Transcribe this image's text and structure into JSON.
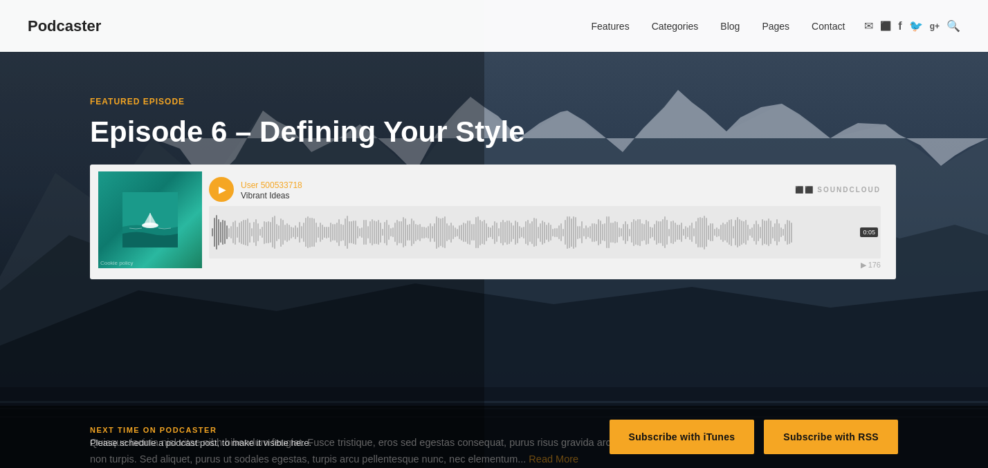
{
  "brand": "Podcaster",
  "nav": {
    "links": [
      {
        "label": "Features",
        "id": "features"
      },
      {
        "label": "Categories",
        "id": "categories"
      },
      {
        "label": "Blog",
        "id": "blog"
      },
      {
        "label": "Pages",
        "id": "pages"
      },
      {
        "label": "Contact",
        "id": "contact"
      }
    ],
    "icons": [
      {
        "name": "mail-icon",
        "glyph": "✉"
      },
      {
        "name": "rss-icon",
        "glyph": "◈"
      },
      {
        "name": "facebook-icon",
        "glyph": "f"
      },
      {
        "name": "twitter-icon",
        "glyph": "t"
      },
      {
        "name": "googleplus-icon",
        "glyph": "g+"
      },
      {
        "name": "search-icon",
        "glyph": "🔍"
      }
    ]
  },
  "hero": {
    "featured_label": "Featured Episode",
    "episode_title": "Episode 6 – Defining Your Style",
    "player": {
      "track_user": "User 500533718",
      "track_name": "Vibrant Ideas",
      "soundcloud_label": "⬛⬛ SOUNDCLOUD",
      "time": "0:05",
      "play_count": "▶ 176",
      "cookie_text": "Cookie policy"
    },
    "description": "Quisque lacinia nisl vitae nibh bibendum feugiat. Fusce tristique, eros sed egestas consequat, purus risus gravida arcu, non euismod lorem libero non turpis. Sed aliquet, purus ut sodales egestas, turpis arcu pellentesque nunc, nec elementum...",
    "read_more": "Read More"
  },
  "footer": {
    "next_label": "NEXT TIME ON PODCASTER",
    "next_text": "Please schedule a podcast post, to make it visible here.",
    "btn_itunes": "Subscribe with iTunes",
    "btn_rss": "Subscribe with RSS"
  }
}
